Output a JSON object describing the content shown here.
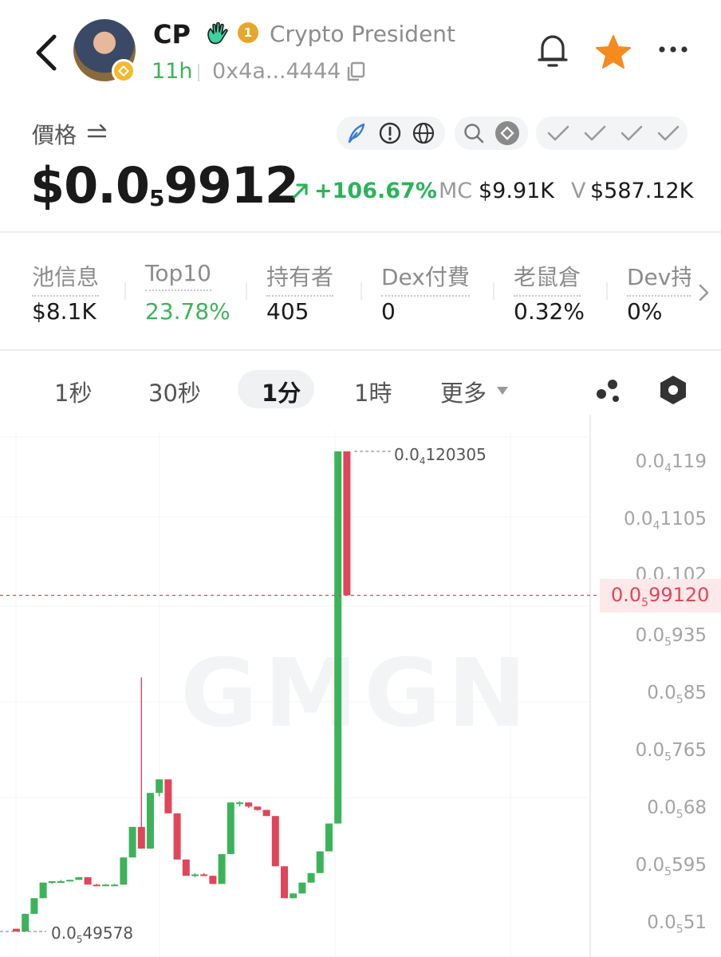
{
  "header": {
    "symbol": "CP",
    "name": "Crypto President",
    "age": "11h",
    "address": "0x4a...4444",
    "rank_badge": "1"
  },
  "price": {
    "label": "價格",
    "prefix": "$0.0",
    "zeros": "5",
    "digits": "9912",
    "change": "+106.67%",
    "mc_label": "MC",
    "mc_value": "$9.91K",
    "v_label": "V",
    "v_value": "$587.12K"
  },
  "stats": [
    {
      "label": "池信息",
      "value": "$8.1K"
    },
    {
      "label": "Top10",
      "value": "23.78%"
    },
    {
      "label": "持有者",
      "value": "405"
    },
    {
      "label": "Dex付費",
      "value": "0"
    },
    {
      "label": "老鼠倉",
      "value": "0.32%"
    },
    {
      "label": "Dev持",
      "value": "0%"
    }
  ],
  "tabs": {
    "t1": "1秒",
    "t2": "30秒",
    "t3": "1分",
    "t4": "1時",
    "more": "更多",
    "active": "1分"
  },
  "colors": {
    "up": "#3cb35a",
    "down": "#e1455a",
    "accent_star": "#f58a1f"
  },
  "chart_data": {
    "type": "candlestick",
    "watermark": "GMGN",
    "y_ticks": [
      {
        "prefix": "0.0",
        "sub": "4",
        "rest": "119"
      },
      {
        "prefix": "0.0",
        "sub": "4",
        "rest": "1105"
      },
      {
        "prefix": "0.0",
        "sub": "4",
        "rest": "102"
      },
      {
        "prefix": "0.0",
        "sub": "5",
        "rest": "935"
      },
      {
        "prefix": "0.0",
        "sub": "5",
        "rest": "85"
      },
      {
        "prefix": "0.0",
        "sub": "5",
        "rest": "765"
      },
      {
        "prefix": "0.0",
        "sub": "5",
        "rest": "68"
      },
      {
        "prefix": "0.0",
        "sub": "5",
        "rest": "595"
      },
      {
        "prefix": "0.0",
        "sub": "5",
        "rest": "51"
      }
    ],
    "current_price": {
      "prefix": "0.0",
      "sub": "5",
      "rest": "99120"
    },
    "high_label": {
      "prefix": "0.0",
      "sub": "4",
      "rest": "120305"
    },
    "low_label": {
      "prefix": "0.0",
      "sub": "5",
      "rest": "49578"
    },
    "candles": [
      {
        "o": 5.0,
        "h": 5.0,
        "l": 4.96,
        "c": 4.96
      },
      {
        "o": 4.96,
        "h": 5.22,
        "l": 4.96,
        "c": 5.22
      },
      {
        "o": 5.22,
        "h": 5.45,
        "l": 5.22,
        "c": 5.45
      },
      {
        "o": 5.45,
        "h": 5.68,
        "l": 5.45,
        "c": 5.68
      },
      {
        "o": 5.68,
        "h": 5.7,
        "l": 5.66,
        "c": 5.7
      },
      {
        "o": 5.7,
        "h": 5.72,
        "l": 5.68,
        "c": 5.7
      },
      {
        "o": 5.7,
        "h": 5.72,
        "l": 5.7,
        "c": 5.72
      },
      {
        "o": 5.72,
        "h": 5.76,
        "l": 5.72,
        "c": 5.76
      },
      {
        "o": 5.76,
        "h": 5.76,
        "l": 5.65,
        "c": 5.65
      },
      {
        "o": 5.65,
        "h": 5.66,
        "l": 5.64,
        "c": 5.64
      },
      {
        "o": 5.64,
        "h": 5.66,
        "l": 5.64,
        "c": 5.65
      },
      {
        "o": 5.65,
        "h": 5.66,
        "l": 5.64,
        "c": 5.65
      },
      {
        "o": 5.65,
        "h": 6.05,
        "l": 5.65,
        "c": 6.05
      },
      {
        "o": 6.05,
        "h": 6.5,
        "l": 6.05,
        "c": 6.5
      },
      {
        "o": 6.5,
        "h": 8.7,
        "l": 6.18,
        "c": 6.18
      },
      {
        "o": 6.18,
        "h": 7.0,
        "l": 6.18,
        "c": 7.0
      },
      {
        "o": 7.0,
        "h": 7.2,
        "l": 6.95,
        "c": 7.2
      },
      {
        "o": 7.2,
        "h": 7.2,
        "l": 6.7,
        "c": 6.7
      },
      {
        "o": 6.7,
        "h": 6.7,
        "l": 6.02,
        "c": 6.02
      },
      {
        "o": 6.02,
        "h": 6.02,
        "l": 5.78,
        "c": 5.78
      },
      {
        "o": 5.78,
        "h": 5.82,
        "l": 5.76,
        "c": 5.8
      },
      {
        "o": 5.8,
        "h": 5.82,
        "l": 5.78,
        "c": 5.78
      },
      {
        "o": 5.78,
        "h": 5.78,
        "l": 5.66,
        "c": 5.66
      },
      {
        "o": 5.66,
        "h": 6.1,
        "l": 5.66,
        "c": 6.1
      },
      {
        "o": 6.1,
        "h": 6.86,
        "l": 6.1,
        "c": 6.86
      },
      {
        "o": 6.86,
        "h": 6.88,
        "l": 6.8,
        "c": 6.86
      },
      {
        "o": 6.86,
        "h": 6.86,
        "l": 6.78,
        "c": 6.8
      },
      {
        "o": 6.8,
        "h": 6.8,
        "l": 6.74,
        "c": 6.75
      },
      {
        "o": 6.75,
        "h": 6.75,
        "l": 6.66,
        "c": 6.66
      },
      {
        "o": 6.66,
        "h": 6.66,
        "l": 5.92,
        "c": 5.92
      },
      {
        "o": 5.92,
        "h": 5.92,
        "l": 5.45,
        "c": 5.45
      },
      {
        "o": 5.45,
        "h": 5.52,
        "l": 5.45,
        "c": 5.52
      },
      {
        "o": 5.52,
        "h": 5.68,
        "l": 5.52,
        "c": 5.68
      },
      {
        "o": 5.68,
        "h": 5.82,
        "l": 5.68,
        "c": 5.82
      },
      {
        "o": 5.82,
        "h": 6.14,
        "l": 5.82,
        "c": 6.14
      },
      {
        "o": 6.14,
        "h": 6.55,
        "l": 6.14,
        "c": 6.55
      },
      {
        "o": 6.55,
        "h": 12.03,
        "l": 6.55,
        "c": 12.03
      },
      {
        "o": 12.03,
        "h": 12.03,
        "l": 9.91,
        "c": 9.91
      }
    ]
  }
}
